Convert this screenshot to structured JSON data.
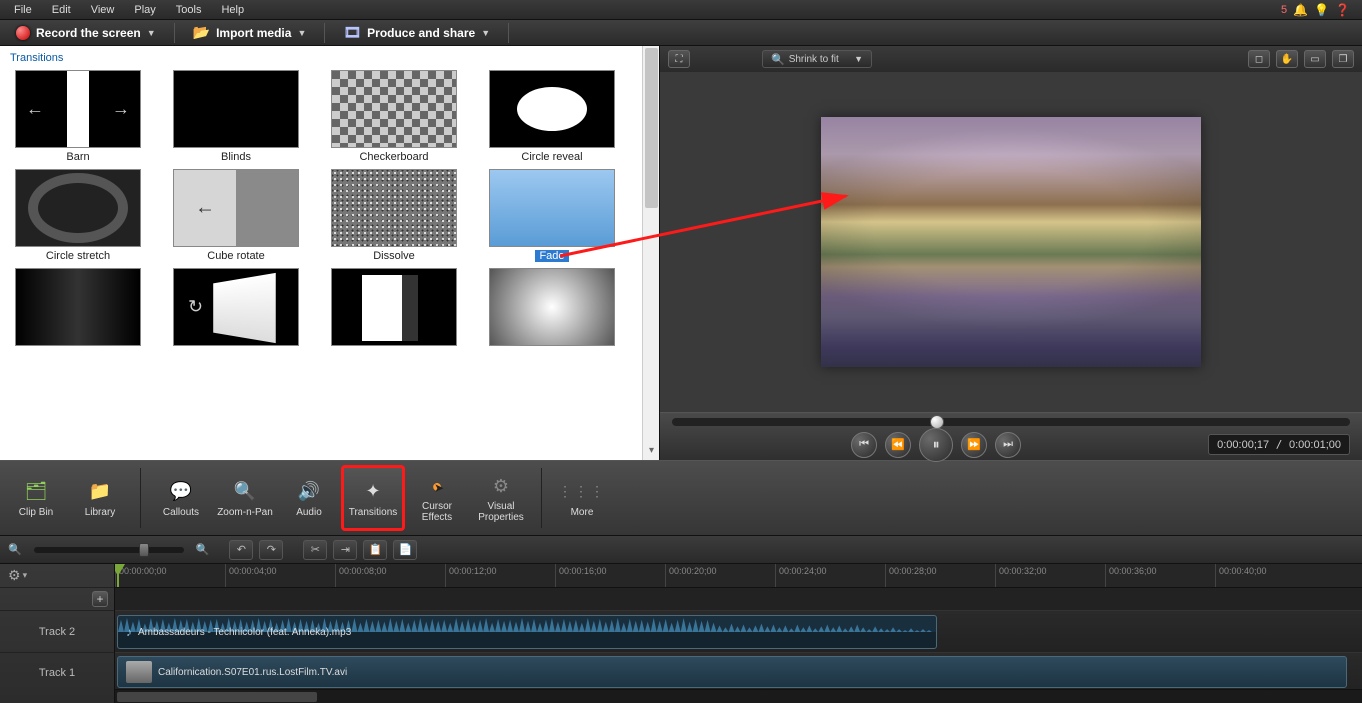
{
  "menu": {
    "file": "File",
    "edit": "Edit",
    "view": "View",
    "play": "Play",
    "tools": "Tools",
    "help": "Help",
    "notif_count": "5"
  },
  "toolbar": {
    "record": "Record the screen",
    "import": "Import media",
    "produce": "Produce and share"
  },
  "panel": {
    "title": "Transitions"
  },
  "transitions": {
    "r1": [
      {
        "l": "Barn"
      },
      {
        "l": "Blinds"
      },
      {
        "l": "Checkerboard"
      },
      {
        "l": "Circle reveal"
      }
    ],
    "r2": [
      {
        "l": "Circle stretch"
      },
      {
        "l": "Cube rotate"
      },
      {
        "l": "Dissolve"
      },
      {
        "l": "Fade",
        "sel": true
      }
    ],
    "r3": [
      {
        "l": ""
      },
      {
        "l": ""
      },
      {
        "l": ""
      },
      {
        "l": ""
      }
    ]
  },
  "preview": {
    "zoom": "Shrink to fit",
    "time_cur": "0:00:00;17",
    "time_tot": "0:00:01;00"
  },
  "tabs": {
    "clipbin": "Clip Bin",
    "library": "Library",
    "callouts": "Callouts",
    "zoom": "Zoom-n-Pan",
    "audio": "Audio",
    "transitions": "Transitions",
    "cursor": "Cursor Effects",
    "visual": "Visual Properties",
    "more": "More"
  },
  "ruler": [
    "00:00:00;00",
    "00:00:04;00",
    "00:00:08;00",
    "00:00:12;00",
    "00:00:16;00",
    "00:00:20;00",
    "00:00:24;00",
    "00:00:28;00",
    "00:00:32;00",
    "00:00:36;00",
    "00:00:40;00"
  ],
  "tracks": {
    "t2": {
      "name": "Track 2",
      "clip": "Ambassadeurs - Technicolor (feat. Anneka).mp3"
    },
    "t1": {
      "name": "Track 1",
      "clip": "Californication.S07E01.rus.LostFilm.TV.avi"
    }
  }
}
